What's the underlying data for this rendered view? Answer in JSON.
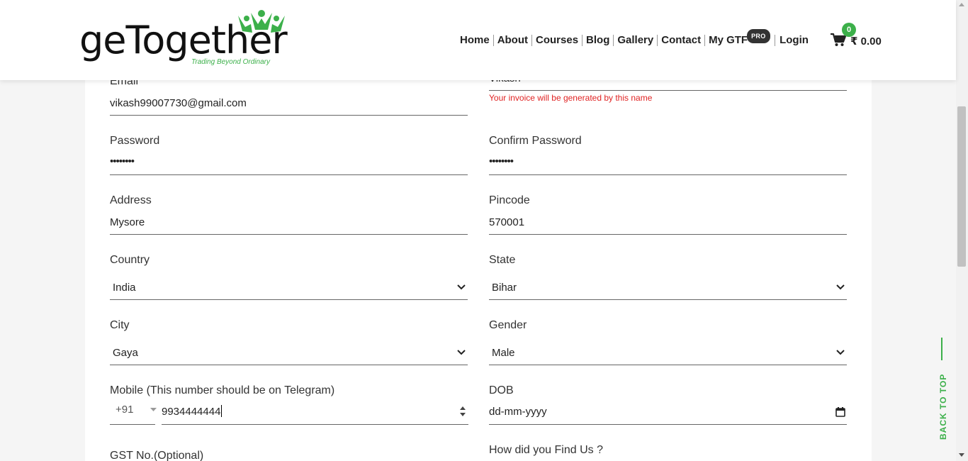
{
  "brand": {
    "name": "geTogether",
    "tagline": "Trading Beyond Ordinary",
    "accent": "#3cb04a"
  },
  "nav": {
    "items": [
      "Home",
      "About",
      "Courses",
      "Blog",
      "Gallery",
      "Contact"
    ],
    "my_gtf": "My GTF",
    "pro_badge": "PRO",
    "login": "Login"
  },
  "cart": {
    "count": "0",
    "total": "₹ 0.00",
    "icon": "cart-icon"
  },
  "form": {
    "email": {
      "label": "Email",
      "value": "vikash99007730@gmail.com"
    },
    "name": {
      "value": "Vikash",
      "note": "Your invoice will be generated by this name"
    },
    "password": {
      "label": "Password",
      "value": "••••••••"
    },
    "confirm_password": {
      "label": "Confirm Password",
      "value": "••••••••"
    },
    "address": {
      "label": "Address",
      "value": "Mysore"
    },
    "pincode": {
      "label": "Pincode",
      "value": "570001"
    },
    "country": {
      "label": "Country",
      "value": "India"
    },
    "state": {
      "label": "State",
      "value": "Bihar"
    },
    "city": {
      "label": "City",
      "value": "Gaya"
    },
    "gender": {
      "label": "Gender",
      "value": "Male"
    },
    "mobile": {
      "label": "Mobile (This number should be on Telegram)",
      "code": "+91",
      "value": "9934444444"
    },
    "dob": {
      "label": "DOB",
      "placeholder": "dd-mm-yyyy"
    },
    "gst": {
      "label": "GST No.(Optional)"
    },
    "find_us": {
      "label": "How did you Find Us ?"
    }
  },
  "back_to_top": "BACK TO TOP",
  "colors": {
    "error": "#e02424",
    "accent": "#3cb04a",
    "text": "#333333"
  }
}
